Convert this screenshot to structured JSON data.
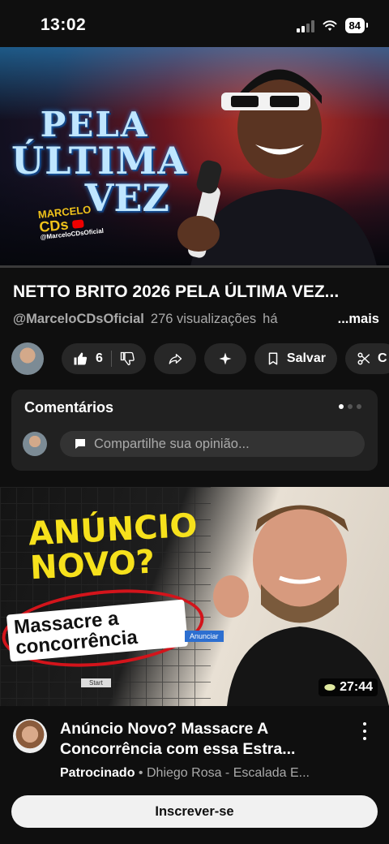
{
  "status_bar": {
    "time": "13:02",
    "battery": "84"
  },
  "video": {
    "thumbnail_text": {
      "line1": "PELA",
      "line2": "ÚLTIMA",
      "line3": "VEZ",
      "logo_top": "MARCELO",
      "logo_big": "CDs",
      "logo_handle": "@MarceloCDsOficial"
    },
    "title": "NETTO BRITO 2026  PELA ÚLTIMA VEZ...",
    "channel_handle": "@MarceloCDsOficial",
    "views": "276 visualizações",
    "age_partial": "há",
    "more_label": "...mais",
    "like_count": "6",
    "save_label": "Salvar",
    "clip_label": "C"
  },
  "comments": {
    "heading": "Comentários",
    "placeholder": "Compartilhe sua opinião..."
  },
  "ad": {
    "headline_line1": "ANÚNCIO",
    "headline_line2": "NOVO?",
    "sub_line1": "Massacre a",
    "sub_line2": "concorrência",
    "button_text": "Anunciar",
    "start_text": "Start",
    "duration": "27:44",
    "title": "Anúncio Novo? Massacre A Concorrência com essa Estra...",
    "sponsored_label": "Patrocinado",
    "separator": "•",
    "advertiser": "Dhiego Rosa - Escalada E...",
    "subscribe_label": "Inscrever-se"
  },
  "colors": {
    "background": "#0f0f0f",
    "chip": "#272727",
    "card": "#212121",
    "accent_yellow": "#f6e11c",
    "accent_red": "#d3141b"
  }
}
